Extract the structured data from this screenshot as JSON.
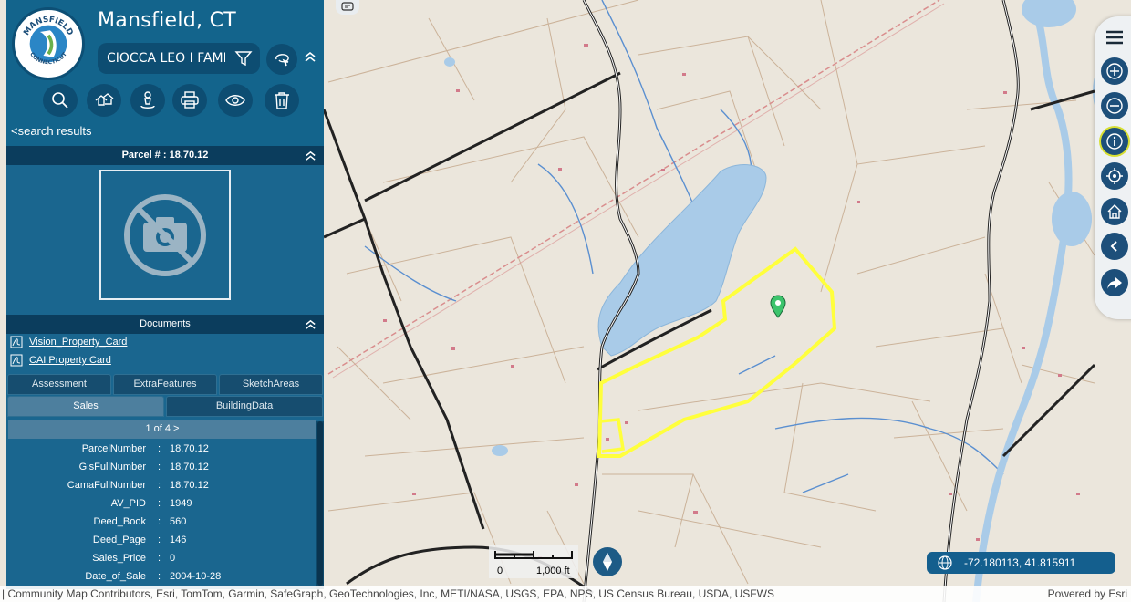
{
  "header": {
    "town_title": "Mansfield, CT",
    "logo_text_top": "MANSFIELD",
    "logo_text_bottom": "CONNECTICUT",
    "search_value": "CIOCCA LEO I FAMIL",
    "back_link": "<search results"
  },
  "toolbar": [
    "search-icon",
    "parcels-icon",
    "user-location-icon",
    "print-icon",
    "eye-icon",
    "trash-icon"
  ],
  "parcel": {
    "title": "Parcel # : 18.70.12"
  },
  "documents": {
    "title": "Documents",
    "items": [
      "Vision_Property_Card",
      "CAI Property Card"
    ]
  },
  "tabs": {
    "row1": [
      "Assessment",
      "ExtraFeatures",
      "SketchAreas"
    ],
    "row2": [
      "Sales",
      "BuildingData"
    ],
    "active": "Sales"
  },
  "sales": {
    "pager": "1 of 4 >",
    "rows": [
      {
        "k": "ParcelNumber",
        "v": "18.70.12"
      },
      {
        "k": "GisFullNumber",
        "v": "18.70.12"
      },
      {
        "k": "CamaFullNumber",
        "v": "18.70.12"
      },
      {
        "k": "AV_PID",
        "v": "1949"
      },
      {
        "k": "Deed_Book",
        "v": "560"
      },
      {
        "k": "Deed_Page",
        "v": "146"
      },
      {
        "k": "Sales_Price",
        "v": "0"
      },
      {
        "k": "Date_of_Sale",
        "v": "2004-10-28"
      }
    ]
  },
  "map": {
    "coordinates": "-72.180113, 41.815911",
    "scale_start": "0",
    "scale_end": "1,000 ft",
    "attribution": "| Community Map Contributors, Esri, TomTom, Garmin, SafeGraph, GeoTechnologies, Inc, METI/NASA, USGS, EPA, NPS, US Census Bureau, USDA, USFWS",
    "powered_by": "Powered by Esri",
    "highlight_color": "#ffff3c",
    "water_color": "#a9cbe8"
  },
  "right_tools": [
    "menu-icon",
    "zoom-in-icon",
    "zoom-out-icon",
    "info-icon",
    "locate-icon",
    "home-icon",
    "back-icon",
    "share-icon"
  ]
}
